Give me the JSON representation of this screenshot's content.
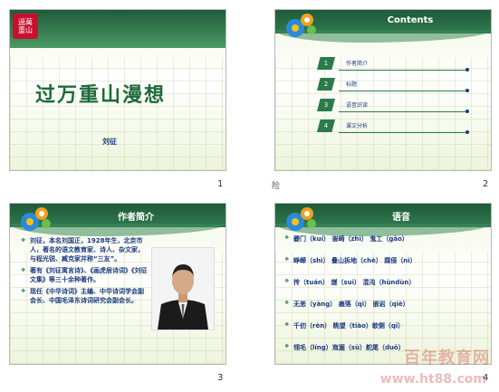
{
  "slide1": {
    "title": "过万重山漫想",
    "author": "刘征",
    "number": "1",
    "seal_text": "過萬重山"
  },
  "slide2": {
    "title": "Contents",
    "number": "2",
    "items": [
      {
        "num": "1",
        "label": "作者简介"
      },
      {
        "num": "2",
        "label": "标题"
      },
      {
        "num": "3",
        "label": "语音识读"
      },
      {
        "num": "4",
        "label": "课文分析"
      }
    ]
  },
  "slide3": {
    "title": "作者简介",
    "number": "3",
    "paragraphs": [
      "刘征，本名刘国正，1928年生，北京市人，著名的语文教育家、诗人、杂文家，与程光锐、臧克家并称“三友”。",
      "著有《刘征寓言诗》、《画虎居诗词》《刘征文集》等三十余种著作。",
      "现任《中华诗词》主编、中华诗词学会副会长、中国毛泽东诗词研究会副会长。"
    ]
  },
  "slide4": {
    "title": "语音",
    "number": "4",
    "lines": [
      "夔门（kuí）  崟崎（zhì）    鬼工（gāo）",
      "峥嵘（shì）  叠山拆地（chè）  蹀侵（nì）",
      "抟（tuán）   燧（suì）  混沌（hùndùn）",
      "无恙（yàng）     瘗落（qì）  嵌岩（qiè）",
      "千仞（rèn）  眺望（tiào）欹侧（qī）",
      "翎毛（líng）迤逦（sù）舵尾（duō）"
    ]
  },
  "stray_label": "险",
  "watermark": {
    "line1": "百年教育网",
    "line2": "www.ht88.com"
  }
}
